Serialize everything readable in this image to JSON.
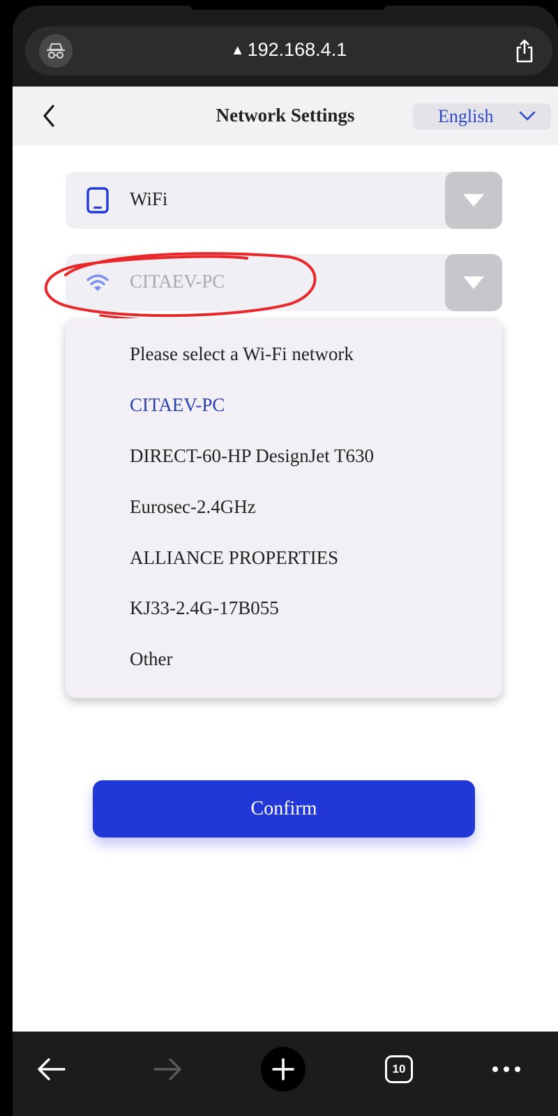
{
  "browser": {
    "url": "192.168.4.1",
    "url_warning_icon": "warning-triangle-icon",
    "incognito_icon": "incognito-icon",
    "share_icon": "share-icon"
  },
  "header": {
    "back_icon": "chevron-left-icon",
    "title": "Network Settings",
    "language": "English",
    "language_icon": "chevron-down-icon"
  },
  "form": {
    "mode_field": {
      "icon": "tablet-icon",
      "value": "WiFi"
    },
    "network_field": {
      "icon": "wifi-icon",
      "value": "CITAEV-PC"
    },
    "network_options": [
      "Please select a Wi-Fi network",
      "CITAEV-PC",
      "DIRECT-60-HP DesignJet T630",
      "Eurosec-2.4GHz",
      "ALLIANCE PROPERTIES",
      "KJ33-2.4G-17B055",
      "Other"
    ],
    "selected_index": 1,
    "confirm_label": "Confirm"
  },
  "toolbar": {
    "tab_count": "10",
    "icons": [
      "arrow-left-icon",
      "arrow-right-icon",
      "plus-icon",
      "tabs-icon",
      "more-icon"
    ]
  },
  "colors": {
    "accent": "#2238d6",
    "selected_text": "#2a3fb0",
    "annotation": "#e8282a"
  }
}
